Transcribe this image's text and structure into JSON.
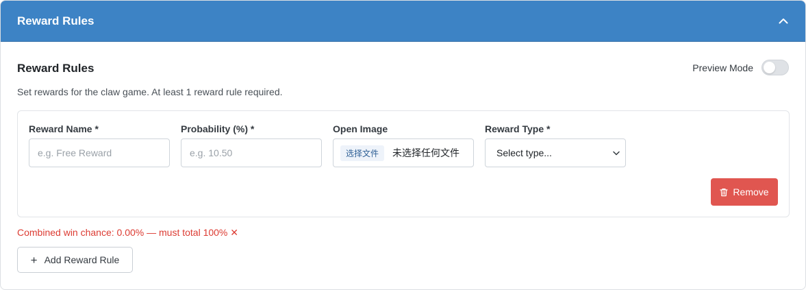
{
  "header": {
    "title": "Reward Rules",
    "collapse_icon": "chevron-up-icon"
  },
  "section": {
    "title": "Reward Rules",
    "description": "Set rewards for the claw game. At least 1 reward rule required.",
    "preview_label": "Preview Mode",
    "preview_enabled": false
  },
  "rule": {
    "reward_name": {
      "label": "Reward Name *",
      "value": "",
      "placeholder": "e.g. Free Reward"
    },
    "probability": {
      "label": "Probability (%) *",
      "value": "",
      "placeholder": "e.g. 10.50"
    },
    "image": {
      "label": "Open Image",
      "button_label": "选择文件",
      "status": "未选择任何文件"
    },
    "reward_type": {
      "label": "Reward Type *",
      "selected": "Select type..."
    },
    "remove_label": "Remove"
  },
  "warning": "Combined win chance: 0.00% — must total 100% ✕",
  "add_button": "Add Reward Rule",
  "colors": {
    "header_bg": "#3d83c5",
    "danger": "#e05650",
    "warning_text": "#dc3b32"
  }
}
